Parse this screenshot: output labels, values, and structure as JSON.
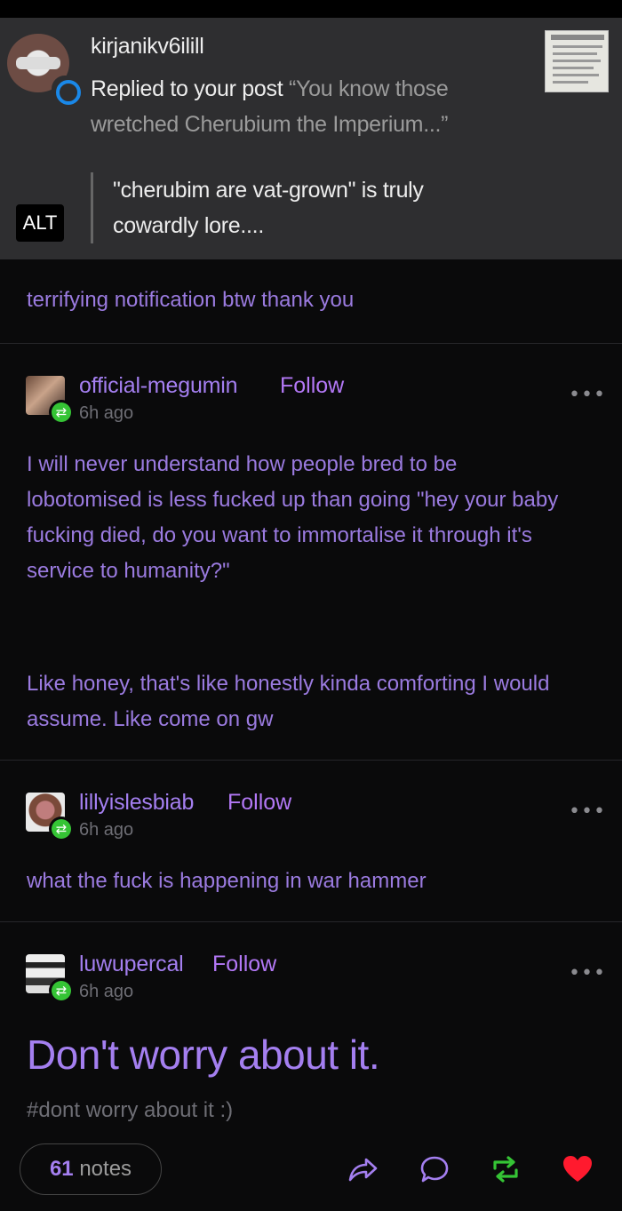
{
  "notification": {
    "username": "kirjanikv6ilill",
    "lead": "Replied to your post",
    "post_excerpt": " “You know those wretched Cherubium the Imperium...”",
    "quote": "\"cherubim are vat-grown\" is truly cowardly lore....",
    "alt_label": "ALT"
  },
  "caption": "terrifying notification btw thank you",
  "posts": [
    {
      "username": "official-megumin",
      "follow": "Follow",
      "time": "6h ago",
      "body": "I will never understand how people bred to be lobotomised is less fucked up than going \"hey your baby fucking died, do you want to immortalise it through it's service to humanity?\"",
      "body2": "Like honey, that's like honestly kinda comforting I would assume. Like come on gw"
    },
    {
      "username": "lillyislesbiab",
      "follow": "Follow",
      "time": "6h ago",
      "body": "what the fuck is happening in war hammer"
    },
    {
      "username": "luwupercal",
      "follow": "Follow",
      "time": "6h ago",
      "body": "Don't worry about it.",
      "tag": "#dont worry about it :)"
    }
  ],
  "more_label": "•••",
  "footer": {
    "notes_count": "61",
    "notes_label": "notes"
  },
  "icons": {
    "share": "share-icon",
    "reply": "reply-icon",
    "reblog": "reblog-icon",
    "like": "heart-icon"
  },
  "colors": {
    "accent": "#a47ff0",
    "reblog_green": "#35c435",
    "like_red": "#ff1a2e"
  }
}
